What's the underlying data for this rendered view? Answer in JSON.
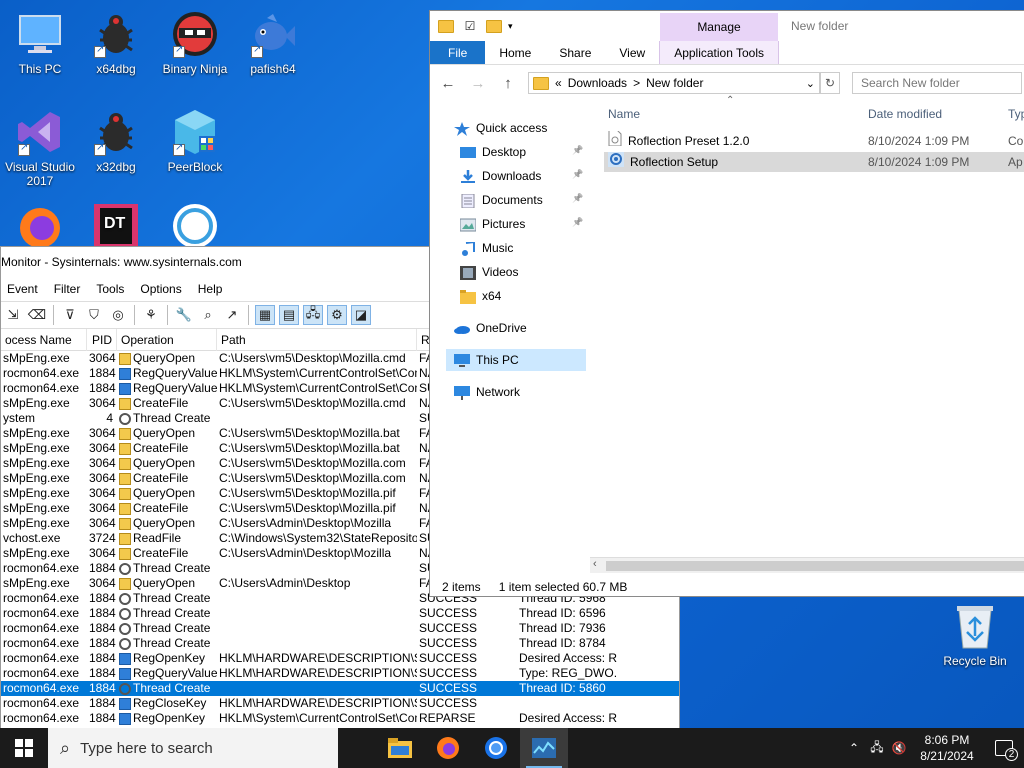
{
  "desktop": {
    "icons": [
      {
        "label": "This PC"
      },
      {
        "label": "x64dbg"
      },
      {
        "label": "Binary Ninja"
      },
      {
        "label": "pafish64"
      },
      {
        "label": "Visual Studio 2017"
      },
      {
        "label": "x32dbg"
      },
      {
        "label": "PeerBlock"
      }
    ],
    "recycle_bin": "Recycle Bin"
  },
  "procmon": {
    "title": "Monitor - Sysinternals: www.sysinternals.com",
    "menu": [
      "Event",
      "Filter",
      "Tools",
      "Options",
      "Help"
    ],
    "columns": [
      "ocess Name",
      "PID",
      "Operation",
      "Path",
      "R"
    ],
    "rows": [
      {
        "proc": "sMpEng.exe",
        "pid": "3064",
        "op": "QueryOpen",
        "icon": "file",
        "path": "C:\\Users\\vm5\\Desktop\\Mozilla.cmd",
        "result": "FA",
        "detail": ""
      },
      {
        "proc": "rocmon64.exe",
        "pid": "1884",
        "op": "RegQueryValue",
        "icon": "reg",
        "path": "HKLM\\System\\CurrentControlSet\\Contr...",
        "result": "NA",
        "detail": ""
      },
      {
        "proc": "rocmon64.exe",
        "pid": "1884",
        "op": "RegQueryValue",
        "icon": "reg",
        "path": "HKLM\\System\\CurrentControlSet\\Contr...",
        "result": "SU",
        "detail": ""
      },
      {
        "proc": "sMpEng.exe",
        "pid": "3064",
        "op": "CreateFile",
        "icon": "file",
        "path": "C:\\Users\\vm5\\Desktop\\Mozilla.cmd",
        "result": "NA",
        "detail": ""
      },
      {
        "proc": "ystem",
        "pid": "4",
        "op": "Thread Create",
        "icon": "proc",
        "path": "",
        "result": "SU",
        "detail": ""
      },
      {
        "proc": "sMpEng.exe",
        "pid": "3064",
        "op": "QueryOpen",
        "icon": "file",
        "path": "C:\\Users\\vm5\\Desktop\\Mozilla.bat",
        "result": "FA",
        "detail": ""
      },
      {
        "proc": "sMpEng.exe",
        "pid": "3064",
        "op": "CreateFile",
        "icon": "file",
        "path": "C:\\Users\\vm5\\Desktop\\Mozilla.bat",
        "result": "NA",
        "detail": ""
      },
      {
        "proc": "sMpEng.exe",
        "pid": "3064",
        "op": "QueryOpen",
        "icon": "file",
        "path": "C:\\Users\\vm5\\Desktop\\Mozilla.com",
        "result": "FA",
        "detail": ""
      },
      {
        "proc": "sMpEng.exe",
        "pid": "3064",
        "op": "CreateFile",
        "icon": "file",
        "path": "C:\\Users\\vm5\\Desktop\\Mozilla.com",
        "result": "NA",
        "detail": ""
      },
      {
        "proc": "sMpEng.exe",
        "pid": "3064",
        "op": "QueryOpen",
        "icon": "file",
        "path": "C:\\Users\\vm5\\Desktop\\Mozilla.pif",
        "result": "FA",
        "detail": ""
      },
      {
        "proc": "sMpEng.exe",
        "pid": "3064",
        "op": "CreateFile",
        "icon": "file",
        "path": "C:\\Users\\vm5\\Desktop\\Mozilla.pif",
        "result": "NA",
        "detail": ""
      },
      {
        "proc": "sMpEng.exe",
        "pid": "3064",
        "op": "QueryOpen",
        "icon": "file",
        "path": "C:\\Users\\Admin\\Desktop\\Mozilla",
        "result": "FA",
        "detail": ""
      },
      {
        "proc": "vchost.exe",
        "pid": "3724",
        "op": "ReadFile",
        "icon": "file",
        "path": "C:\\Windows\\System32\\StateRepository...",
        "result": "SU",
        "detail": ""
      },
      {
        "proc": "sMpEng.exe",
        "pid": "3064",
        "op": "CreateFile",
        "icon": "file",
        "path": "C:\\Users\\Admin\\Desktop\\Mozilla",
        "result": "NA",
        "detail": ""
      },
      {
        "proc": "rocmon64.exe",
        "pid": "1884",
        "op": "Thread Create",
        "icon": "proc",
        "path": "",
        "result": "SU",
        "detail": ""
      },
      {
        "proc": "sMpEng.exe",
        "pid": "3064",
        "op": "QueryOpen",
        "icon": "file",
        "path": "C:\\Users\\Admin\\Desktop",
        "result": "FA",
        "detail": ""
      },
      {
        "proc": "rocmon64.exe",
        "pid": "1884",
        "op": "Thread Create",
        "icon": "proc",
        "path": "",
        "result": "SUCCESS",
        "detail": "Thread ID: 5968"
      },
      {
        "proc": "rocmon64.exe",
        "pid": "1884",
        "op": "Thread Create",
        "icon": "proc",
        "path": "",
        "result": "SUCCESS",
        "detail": "Thread ID: 6596"
      },
      {
        "proc": "rocmon64.exe",
        "pid": "1884",
        "op": "Thread Create",
        "icon": "proc",
        "path": "",
        "result": "SUCCESS",
        "detail": "Thread ID: 7936"
      },
      {
        "proc": "rocmon64.exe",
        "pid": "1884",
        "op": "Thread Create",
        "icon": "proc",
        "path": "",
        "result": "SUCCESS",
        "detail": "Thread ID: 8784"
      },
      {
        "proc": "rocmon64.exe",
        "pid": "1884",
        "op": "RegOpenKey",
        "icon": "reg",
        "path": "HKLM\\HARDWARE\\DESCRIPTION\\S...",
        "result": "SUCCESS",
        "detail": "Desired Access: R..."
      },
      {
        "proc": "rocmon64.exe",
        "pid": "1884",
        "op": "RegQueryValue",
        "icon": "reg",
        "path": "HKLM\\HARDWARE\\DESCRIPTION\\S...",
        "result": "SUCCESS",
        "detail": "Type: REG_DWO..."
      },
      {
        "proc": "rocmon64.exe",
        "pid": "1884",
        "op": "Thread Create",
        "icon": "proc",
        "path": "",
        "result": "SUCCESS",
        "detail": "Thread ID: 5860",
        "selected": true
      },
      {
        "proc": "rocmon64.exe",
        "pid": "1884",
        "op": "RegCloseKey",
        "icon": "reg",
        "path": "HKLM\\HARDWARE\\DESCRIPTION\\S...",
        "result": "SUCCESS",
        "detail": ""
      },
      {
        "proc": "rocmon64.exe",
        "pid": "1884",
        "op": "RegOpenKey",
        "icon": "reg",
        "path": "HKLM\\System\\CurrentControlSet\\Contr...",
        "result": "REPARSE",
        "detail": "Desired Access: R..."
      }
    ]
  },
  "explorer": {
    "title": "New folder",
    "manage_tab": "Manage",
    "ribbon_tabs": [
      "File",
      "Home",
      "Share",
      "View",
      "Application Tools"
    ],
    "breadcrumb": [
      "«",
      "Downloads",
      ">",
      "New folder"
    ],
    "search_placeholder": "Search New folder",
    "nav": {
      "quick_access": "Quick access",
      "items": [
        "Desktop",
        "Downloads",
        "Documents",
        "Pictures",
        "Music",
        "Videos",
        "x64"
      ],
      "onedrive": "OneDrive",
      "thispc": "This PC",
      "network": "Network"
    },
    "columns": [
      "Name",
      "Date modified",
      "Typ"
    ],
    "files": [
      {
        "name": "Roflection Preset 1.2.0",
        "date": "8/10/2024 1:09 PM",
        "type": "Co"
      },
      {
        "name": "Roflection Setup",
        "date": "8/10/2024 1:09 PM",
        "type": "Ap"
      }
    ],
    "status": {
      "count": "2 items",
      "selection": "1 item selected  60.7 MB"
    }
  },
  "taskbar": {
    "search_placeholder": "Type here to search",
    "time": "8:06 PM",
    "date": "8/21/2024",
    "notif_count": "2"
  }
}
